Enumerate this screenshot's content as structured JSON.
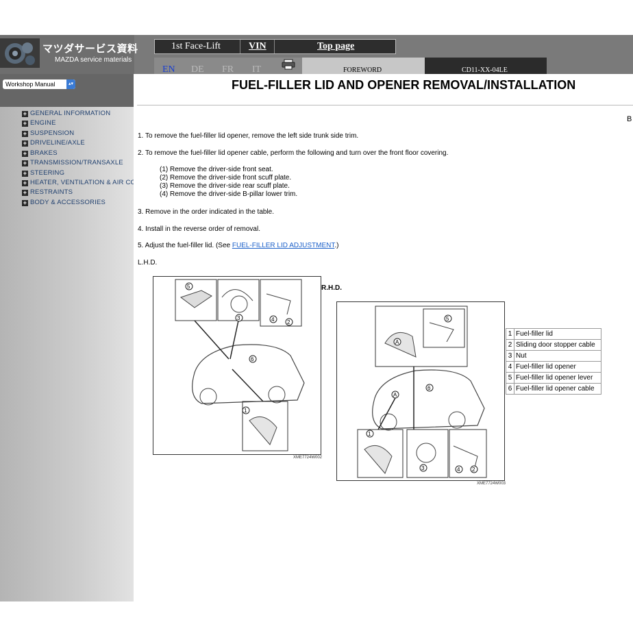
{
  "header": {
    "logo_jp": "マツダサービス資料",
    "logo_en": "MAZDA service materials",
    "nav": [
      "1st Face-Lift",
      "VIN",
      "Top page"
    ],
    "languages": [
      "EN",
      "DE",
      "FR",
      "IT"
    ],
    "foreword": "FOREWORD",
    "code": "CD11-XX-04LE"
  },
  "sidebar": {
    "select_value": "Workshop Manual",
    "items": [
      "GENERAL INFORMATION",
      "ENGINE",
      "SUSPENSION",
      "DRIVELINE/AXLE",
      "BRAKES",
      "TRANSMISSION/TRANSAXLE",
      "STEERING",
      "HEATER, VENTILATION & AIR CONDITIONING",
      "RESTRAINTS",
      "BODY & ACCESSORIES"
    ]
  },
  "main": {
    "title": "FUEL-FILLER LID AND OPENER REMOVAL/INSTALLATION",
    "cut_char": "B",
    "steps": {
      "s1": "1. To remove the fuel-filler lid opener, remove the left side trunk side trim.",
      "s2": "2. To remove the fuel-filler lid opener cable, perform the following and turn over the front floor covering.",
      "sub": [
        "(1) Remove the driver-side front seat.",
        "(2) Remove the driver-side front scuff plate.",
        "(3) Remove the driver-side rear scuff plate.",
        "(4) Remove the driver-side B-pillar lower trim."
      ],
      "s3": "3. Remove in the order indicated in the table.",
      "s4": "4. Install in the reverse order of removal.",
      "s5_pre": "5. Adjust the fuel-filler lid. (See ",
      "s5_link": "FUEL-FILLER LID ADJUSTMENT",
      "s5_post": ".)"
    },
    "lhd_label": "L.H.D.",
    "rhd_label": "R.H.D.",
    "fig1_caption": "XME7724W002",
    "fig2_caption": "XME7724W003",
    "legend": [
      {
        "num": "1",
        "label": "Fuel-filler lid"
      },
      {
        "num": "2",
        "label": "Sliding door stopper cable"
      },
      {
        "num": "3",
        "label": "Nut"
      },
      {
        "num": "4",
        "label": "Fuel-filler lid opener"
      },
      {
        "num": "5",
        "label": "Fuel-filler lid opener lever"
      },
      {
        "num": "6",
        "label": "Fuel-filler lid opener cable"
      }
    ],
    "callouts": [
      "1",
      "2",
      "3",
      "4",
      "5",
      "6",
      "A"
    ]
  }
}
